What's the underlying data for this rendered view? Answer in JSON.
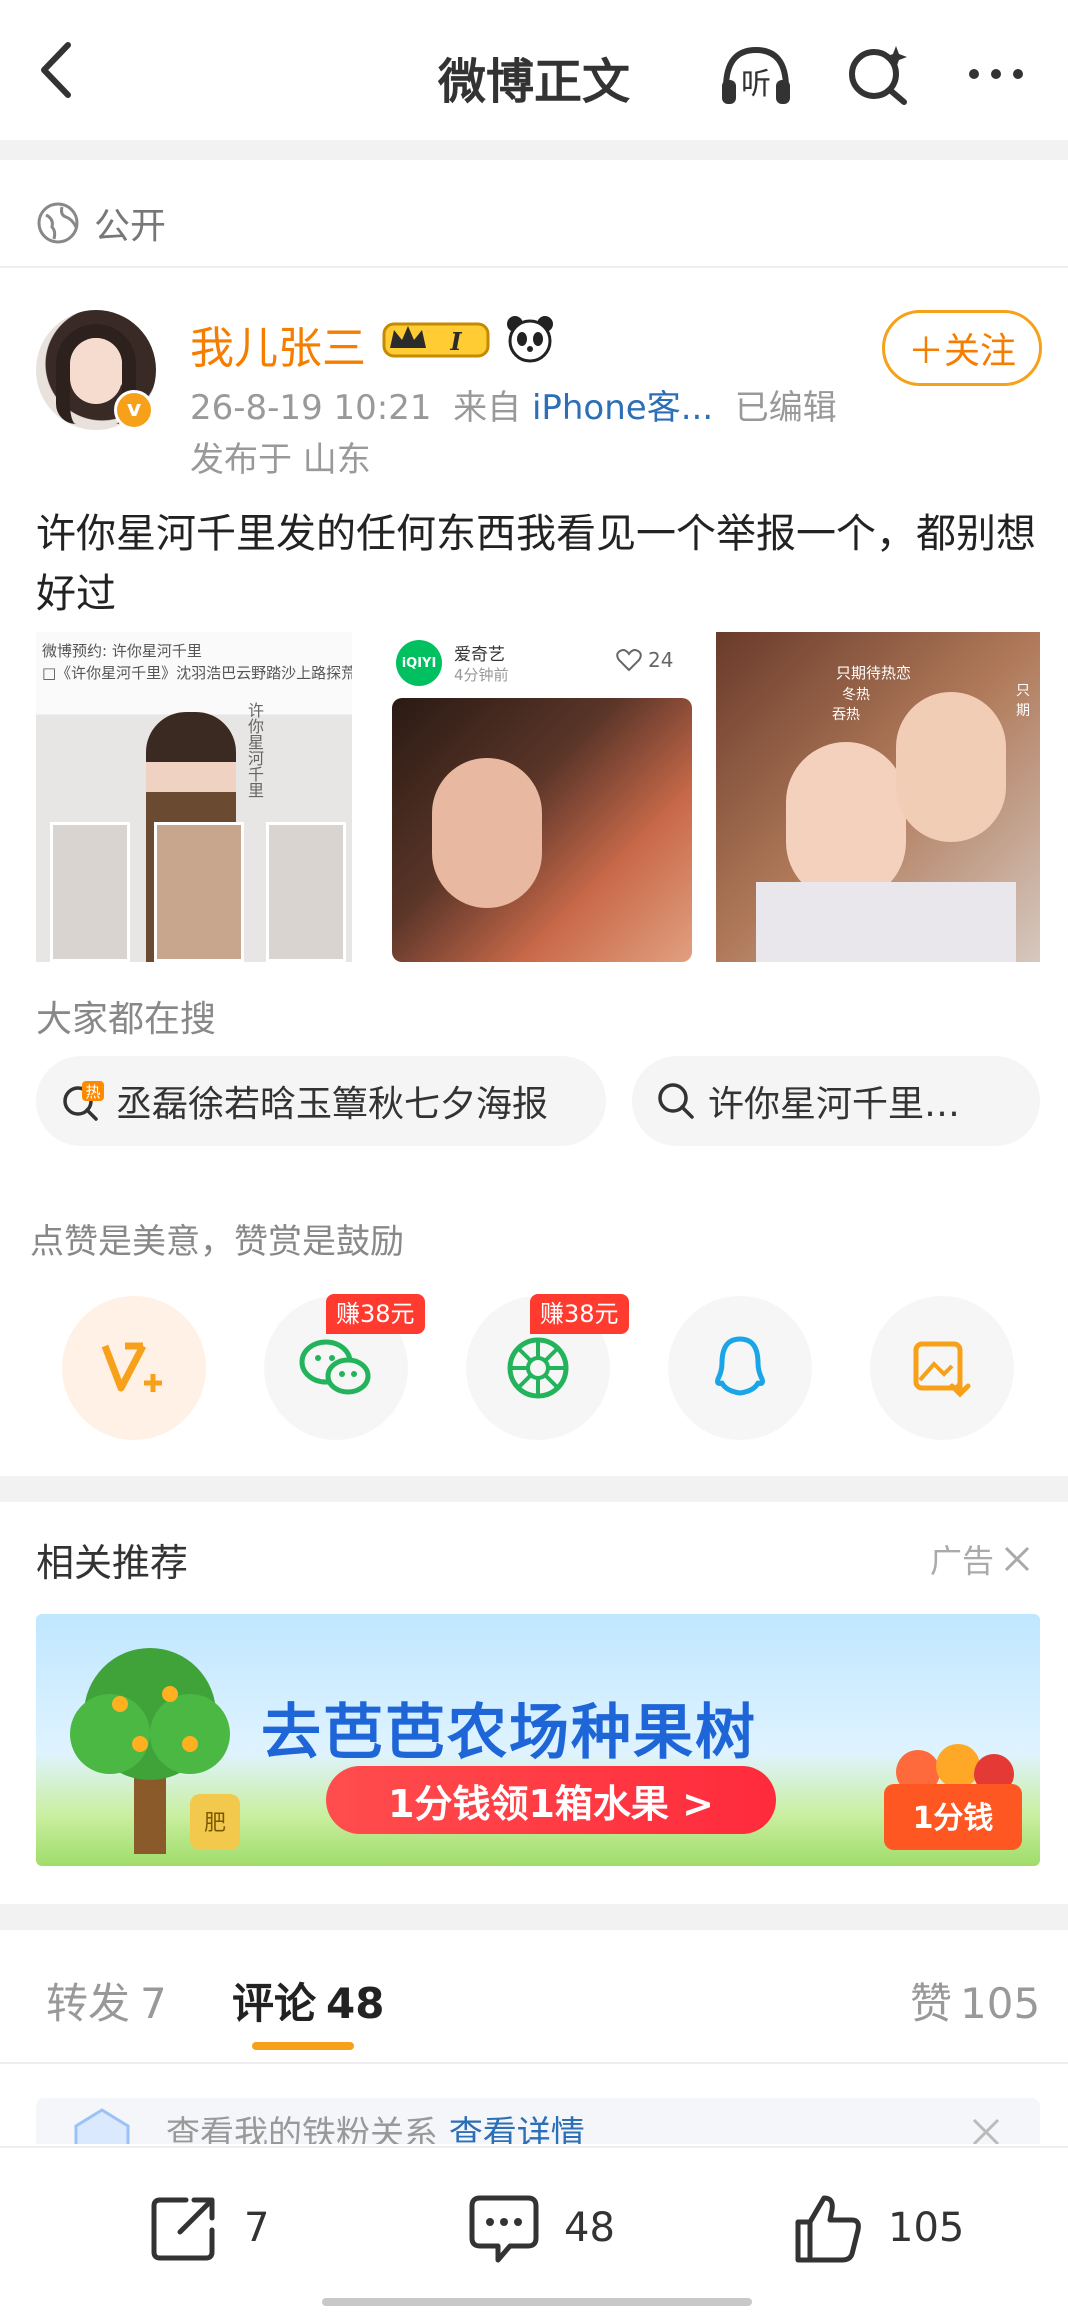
{
  "header": {
    "title": "微博正文",
    "listen_label": "听"
  },
  "visibility": {
    "label": "公开"
  },
  "post": {
    "username": "我儿张三",
    "member_badge": "I",
    "vip_mark": "v",
    "datetime": "26-8-19 10:21",
    "source_prefix": "来自",
    "source": "iPhone客...",
    "edited": "已编辑",
    "location": "发布于 山东",
    "follow_label": "＋关注",
    "text": "许你星河千里发的任何东西我看见一个举报一个，都别想好过",
    "images": [
      {
        "lines": [
          "微博预约: 许你星河千里",
          "□《许你星河千里》沈羽浩巴云野踏沙上路探荒野"
        ],
        "vertical_text": "许你星河千里"
      },
      {
        "app_name": "爱奇艺",
        "app_logo": "iQIYI",
        "time_ago": "4分钟前",
        "likes": "24"
      },
      {
        "overlay_1": "只期待热恋",
        "overlay_2": "冬热",
        "overlay_3": "吞热",
        "overlay_4": "吞热",
        "overlay_5": "只期"
      }
    ]
  },
  "hot_search": {
    "label": "大家都在搜",
    "items": [
      {
        "text": "丞磊徐若晗玉簟秋七夕海报",
        "hot_tag": "热"
      },
      {
        "text": "许你星河千里…"
      }
    ]
  },
  "reward": {
    "prompt": "点赞是美意，赞赏是鼓励",
    "share_targets": [
      {
        "icon": "weibo-reward-icon"
      },
      {
        "icon": "wechat-icon",
        "badge": "赚38元"
      },
      {
        "icon": "moments-icon",
        "badge": "赚38元"
      },
      {
        "icon": "qq-icon"
      },
      {
        "icon": "save-image-icon"
      }
    ]
  },
  "related": {
    "label": "相关推荐",
    "ad_label": "广告",
    "banner": {
      "headline": "去芭芭农场种果树",
      "cta": "1分钱领1箱水果 >",
      "tag": "1分钱",
      "fertilizer": "肥"
    }
  },
  "tabs": [
    {
      "label": "转发",
      "count": "7"
    },
    {
      "label": "评论",
      "count": "48"
    },
    {
      "label": "赞",
      "count": "105"
    }
  ],
  "fans_notice": {
    "text": "查看我的铁粉关系",
    "link": "查看详情"
  },
  "bottom_bar": {
    "repost_count": "7",
    "comment_count": "48",
    "like_count": "105"
  },
  "colors": {
    "accent": "#f7a11a",
    "username": "#f57d00",
    "link": "#2c6fb7",
    "earn_badge": "#ff3b30"
  }
}
